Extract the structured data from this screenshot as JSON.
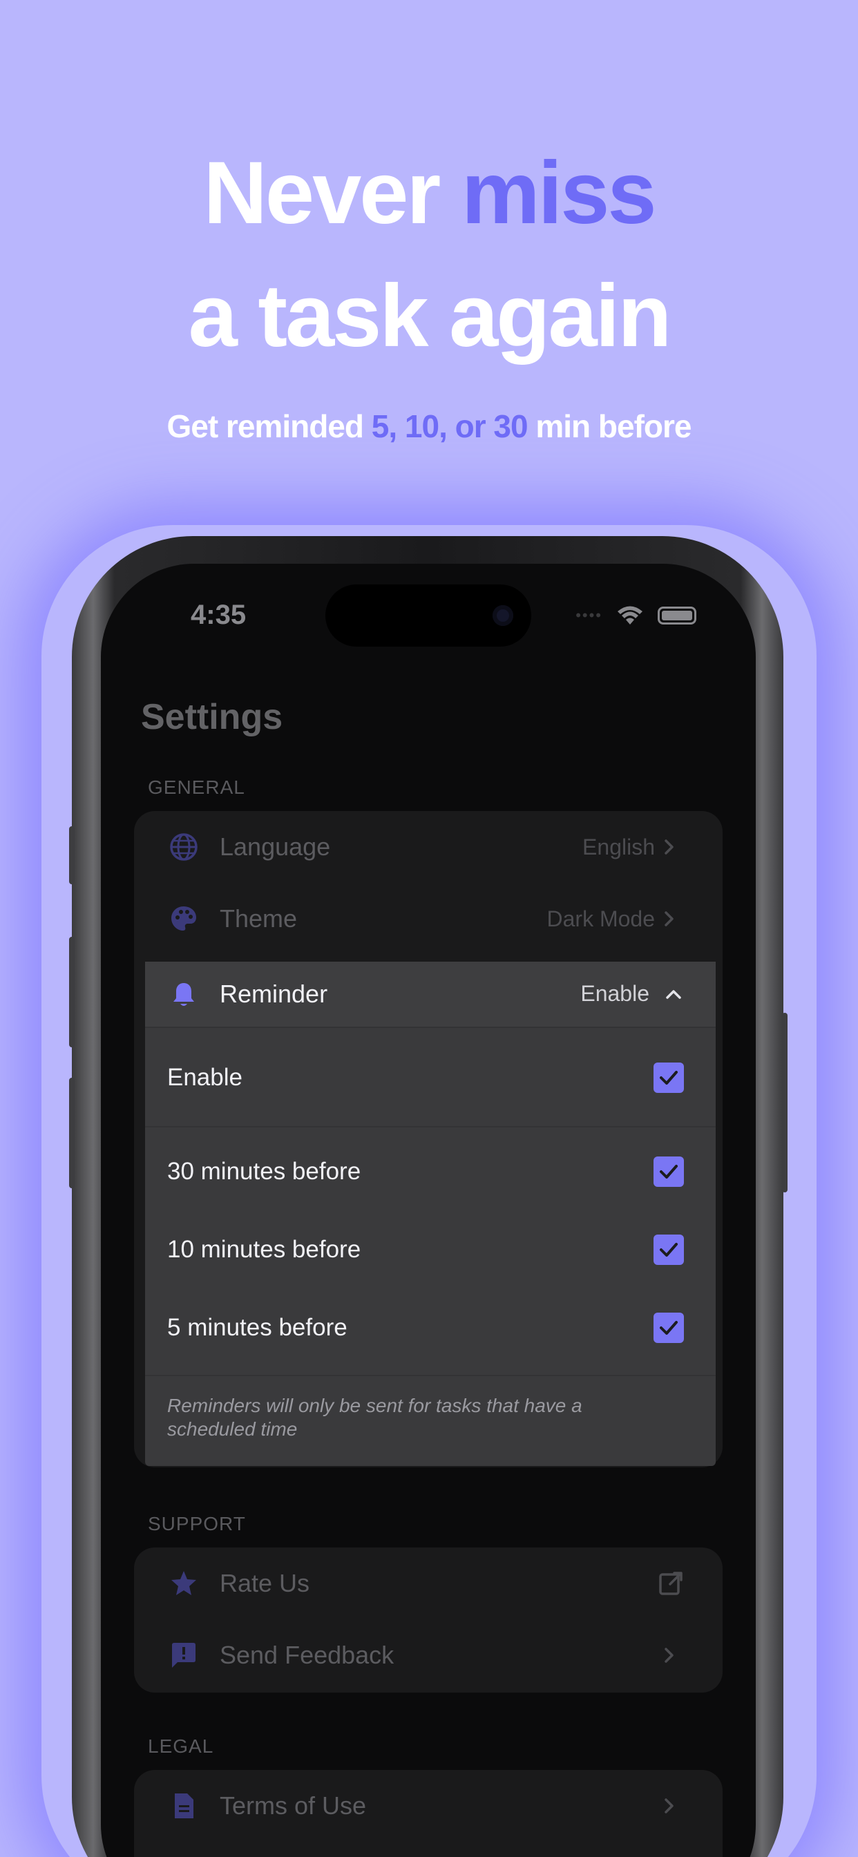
{
  "headline": {
    "line1_plain": "Never ",
    "line1_accent": "miss",
    "line2": "a task again",
    "sub_plain": "Get reminded ",
    "sub_accent": "5, 10, or 30",
    "sub_tail": " min before"
  },
  "status_bar": {
    "time": "4:35"
  },
  "settings": {
    "title": "Settings",
    "general": {
      "label": "GENERAL",
      "items": [
        {
          "label": "Language",
          "value": "English",
          "icon": "globe-icon"
        },
        {
          "label": "Theme",
          "value": "Dark Mode",
          "icon": "palette-icon"
        }
      ]
    },
    "reminder": {
      "label": "Reminder",
      "value": "Enable",
      "icon": "bell-icon",
      "options": [
        {
          "label": "Enable",
          "checked": true
        },
        {
          "label": "30 minutes before",
          "checked": true
        },
        {
          "label": "10 minutes before",
          "checked": true
        },
        {
          "label": "5 minutes before",
          "checked": true
        }
      ],
      "note": "Reminders will only be sent for tasks that have a scheduled time"
    },
    "support": {
      "label": "SUPPORT",
      "items": [
        {
          "label": "Rate Us",
          "icon": "star-icon",
          "trailing": "external-link-icon"
        },
        {
          "label": "Send Feedback",
          "icon": "feedback-icon",
          "trailing": "chevron-right-icon"
        }
      ]
    },
    "legal": {
      "label": "LEGAL",
      "items": [
        {
          "label": "Terms of Use",
          "icon": "document-icon",
          "trailing": "chevron-right-icon"
        }
      ]
    }
  },
  "colors": {
    "background": "#b9b6fd",
    "accent": "#6f6cf6",
    "checkbox": "#7a76f4",
    "icon_dim": "#3b3a7a",
    "icon_active": "#7a76f4"
  }
}
